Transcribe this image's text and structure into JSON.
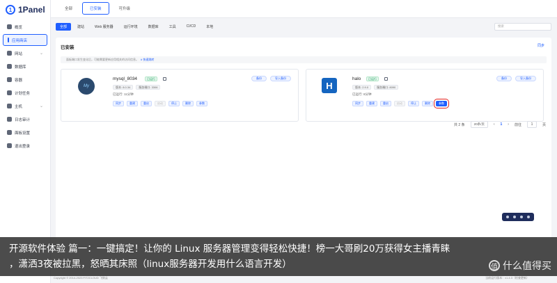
{
  "app": {
    "name": "1Panel"
  },
  "sidebar": {
    "items": [
      {
        "label": "概览",
        "icon": "home-icon",
        "expandable": false
      },
      {
        "label": "应用商店",
        "icon": "store-icon",
        "active": true,
        "expandable": false
      },
      {
        "label": "网站",
        "icon": "globe-icon",
        "expandable": true
      },
      {
        "label": "数据库",
        "icon": "database-icon",
        "expandable": false
      },
      {
        "label": "容器",
        "icon": "container-icon",
        "expandable": false
      },
      {
        "label": "计划任务",
        "icon": "calendar-icon",
        "expandable": false
      },
      {
        "label": "主机",
        "icon": "host-icon",
        "expandable": true
      },
      {
        "label": "日志审计",
        "icon": "log-icon",
        "expandable": false
      },
      {
        "label": "面板设置",
        "icon": "settings-icon",
        "expandable": false
      },
      {
        "label": "退出登录",
        "icon": "logout-icon",
        "expandable": false
      }
    ],
    "expand_arrow": "⌄"
  },
  "top_tabs": [
    {
      "label": "全部"
    },
    {
      "label": "已安装",
      "active": true
    },
    {
      "label": "可升级"
    }
  ],
  "categories": [
    {
      "label": "全部",
      "active": true
    },
    {
      "label": "建站"
    },
    {
      "label": "Web 服务器"
    },
    {
      "label": "运行环境"
    },
    {
      "label": "数据库"
    },
    {
      "label": "工具"
    },
    {
      "label": "CI/CD"
    },
    {
      "label": "本地"
    }
  ],
  "search": {
    "placeholder": "搜索"
  },
  "installed": {
    "title": "已安装",
    "refresh": "同步",
    "tip_text": "面板端口发生变化后，可能需要更新应用相关的访问信息。",
    "tip_link": "# 快速跳转"
  },
  "apps": [
    {
      "name": "mysql_8034",
      "status": "已运行",
      "logo_text": "My",
      "version": "版本: 8.0.34",
      "port": "服务端口: 3306",
      "uptime": "已运行:  11分钟",
      "top_buttons": [
        "备份",
        "导入备份"
      ],
      "actions": [
        {
          "label": "同步"
        },
        {
          "label": "重建"
        },
        {
          "label": "重启"
        },
        {
          "label": "启动",
          "disabled": true
        },
        {
          "label": "停止"
        },
        {
          "label": "删除"
        },
        {
          "label": "参数"
        }
      ]
    },
    {
      "name": "halo",
      "status": "已运行",
      "logo_text": "H",
      "version": "版本: 2.9.0",
      "port": "服务端口: 8090",
      "uptime": "已运行:  8分钟",
      "top_buttons": [
        "备份",
        "导入备份"
      ],
      "actions": [
        {
          "label": "同步"
        },
        {
          "label": "重建"
        },
        {
          "label": "重启"
        },
        {
          "label": "启动",
          "disabled": true
        },
        {
          "label": "停止"
        },
        {
          "label": "删除"
        },
        {
          "label": "参数",
          "highlighted": true
        }
      ]
    }
  ],
  "pagination": {
    "total": "共 2 条",
    "page_size": "20条/页",
    "prev": "‹",
    "current": "1",
    "next": "›",
    "goto_label": "前往",
    "goto_value": "1",
    "goto_suffix": "页"
  },
  "footer": {
    "copyright": "Copyright © 2014-2023 FIT2CLOUD 飞致云",
    "version": "当前运行版本：v1.4.3（检查更新）"
  },
  "caption": {
    "line1": "开源软件体验 篇一：一键搞定！让你的 Linux 服务器管理变得轻松快捷！榜一大哥刷20万获得女主播青睐",
    "line2": "，潇洒3夜被拉黑，怒晒其床照（linux服务器开发用什么语言开发）"
  },
  "watermark": {
    "text": "什么值得买",
    "icon_text": "值"
  },
  "colors": {
    "accent": "#1f5eff",
    "success": "#19a15f",
    "highlight": "#e02020"
  }
}
